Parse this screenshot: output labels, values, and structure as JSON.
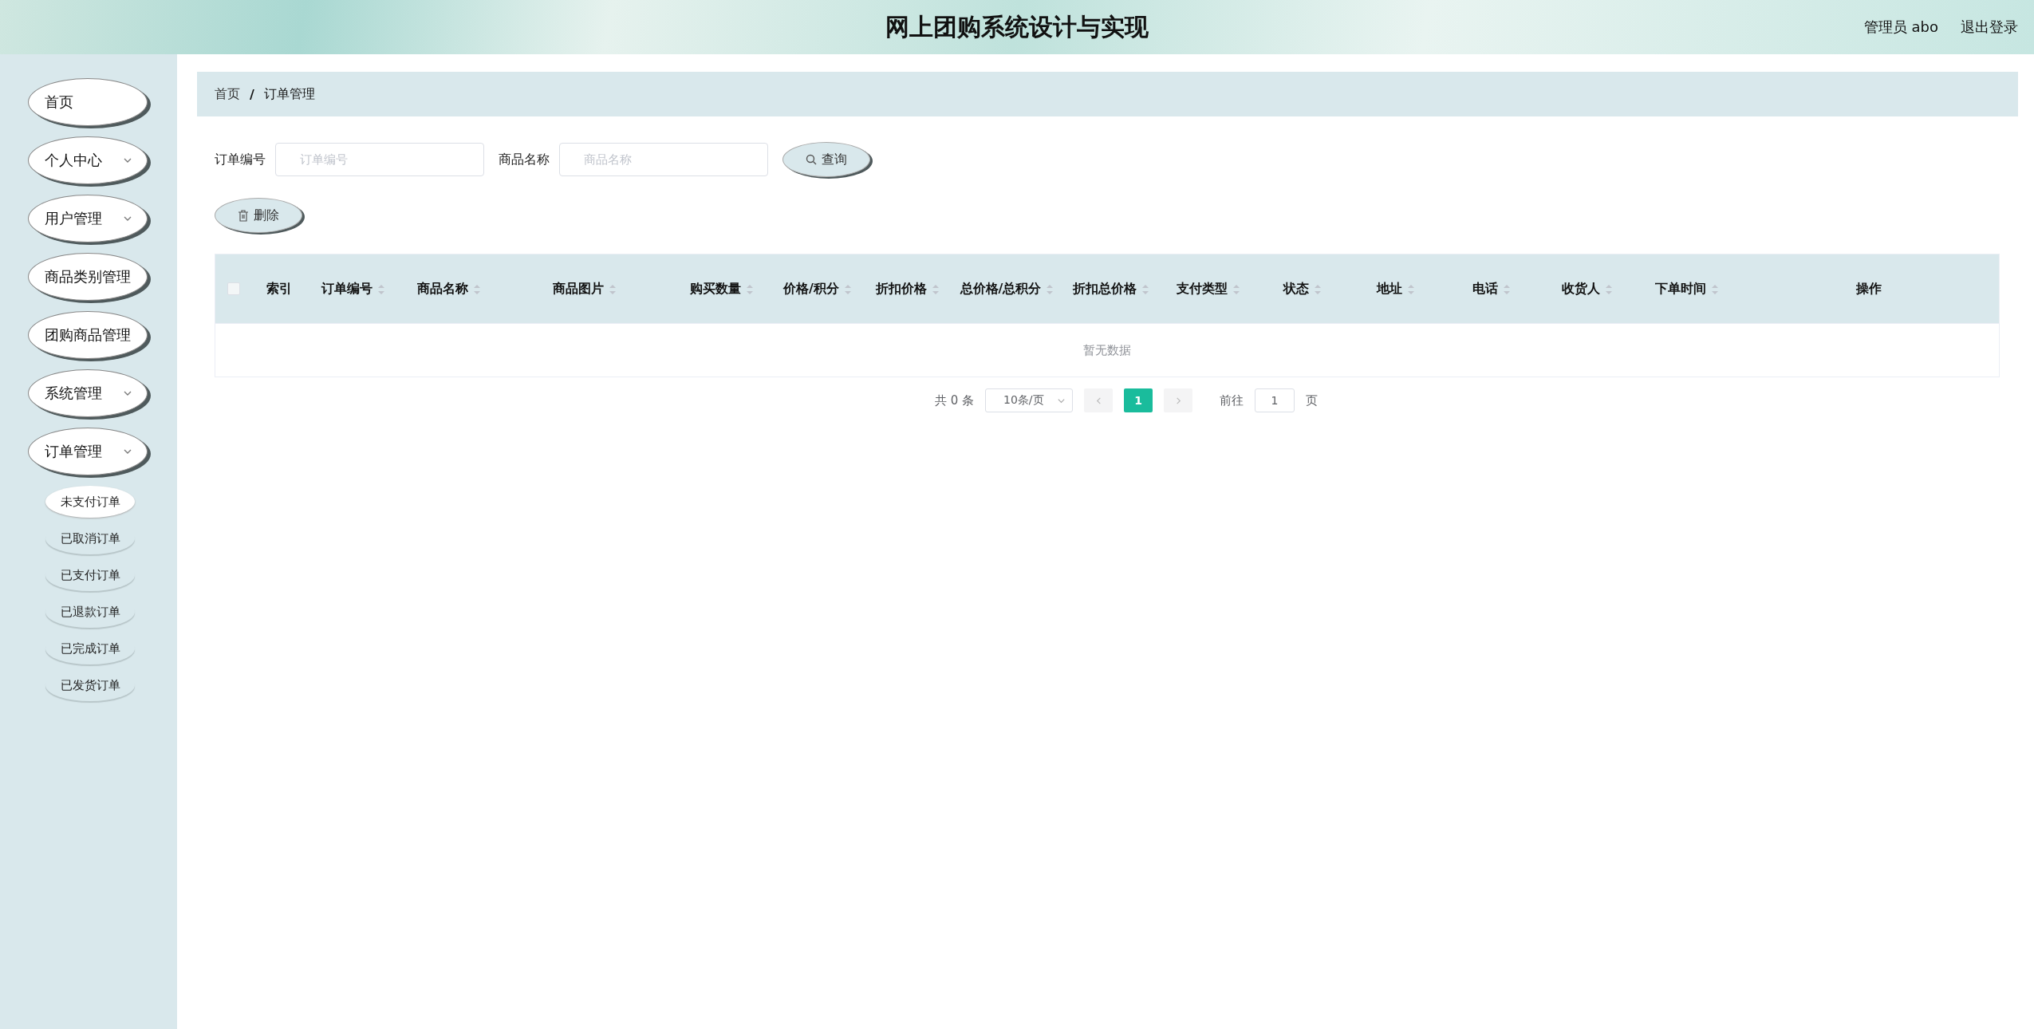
{
  "header": {
    "title": "网上团购系统设计与实现",
    "user": "管理员 abo",
    "logout": "退出登录"
  },
  "sidebar": {
    "items": [
      {
        "label": "首页",
        "kind": "link"
      },
      {
        "label": "个人中心",
        "kind": "group"
      },
      {
        "label": "用户管理",
        "kind": "group"
      },
      {
        "label": "商品类别管理",
        "kind": "link"
      },
      {
        "label": "团购商品管理",
        "kind": "link"
      },
      {
        "label": "系统管理",
        "kind": "group"
      },
      {
        "label": "订单管理",
        "kind": "group",
        "children": [
          {
            "label": "未支付订单",
            "selected": true
          },
          {
            "label": "已取消订单",
            "selected": false
          },
          {
            "label": "已支付订单",
            "selected": false
          },
          {
            "label": "已退款订单",
            "selected": false
          },
          {
            "label": "已完成订单",
            "selected": false
          },
          {
            "label": "已发货订单",
            "selected": false
          }
        ]
      }
    ]
  },
  "breadcrumb": {
    "items": [
      "首页",
      "订单管理"
    ],
    "separator": "/"
  },
  "search": {
    "fields": [
      {
        "label": "订单编号",
        "placeholder": "订单编号"
      },
      {
        "label": "商品名称",
        "placeholder": "商品名称"
      }
    ],
    "button": "查询"
  },
  "toolbar": {
    "delete": "删除"
  },
  "table": {
    "header_checkbox": {
      "checked": false
    },
    "columns": [
      {
        "label": "索引",
        "sortable": false
      },
      {
        "label": "订单编号",
        "sortable": true
      },
      {
        "label": "商品名称",
        "sortable": true
      },
      {
        "label": "商品图片",
        "sortable": true
      },
      {
        "label": "购买数量",
        "sortable": true
      },
      {
        "label": "价格/积分",
        "sortable": true
      },
      {
        "label": "折扣价格",
        "sortable": true
      },
      {
        "label": "总价格/总积分",
        "sortable": true
      },
      {
        "label": "折扣总价格",
        "sortable": true
      },
      {
        "label": "支付类型",
        "sortable": true
      },
      {
        "label": "状态",
        "sortable": true
      },
      {
        "label": "地址",
        "sortable": true
      },
      {
        "label": "电话",
        "sortable": true
      },
      {
        "label": "收货人",
        "sortable": true
      },
      {
        "label": "下单时间",
        "sortable": true
      },
      {
        "label": "操作",
        "sortable": false
      }
    ],
    "empty_text": "暂无数据"
  },
  "pagination": {
    "total": "共 0 条",
    "page_size": "10条/页",
    "pages": [
      {
        "label": "1",
        "selected": true
      }
    ],
    "goto_label": "前往",
    "goto_value": "1",
    "goto_suffix": "页"
  }
}
